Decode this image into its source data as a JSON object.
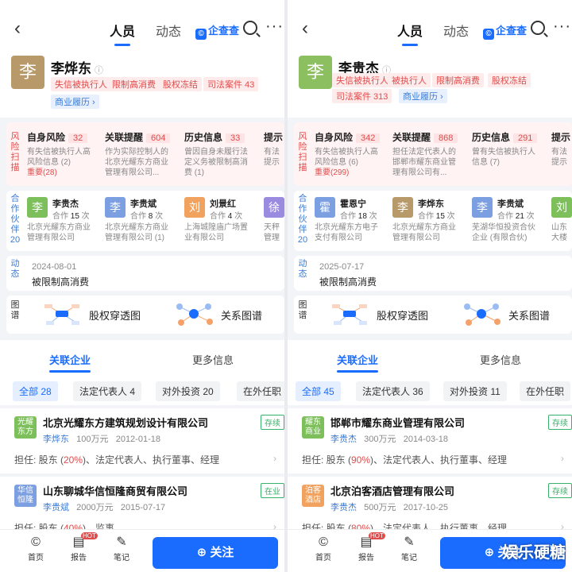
{
  "header": {
    "tab_people": "人员",
    "tab_news": "动态",
    "qcc": "企查查"
  },
  "bottom": {
    "home": "首页",
    "report": "报告",
    "hot": "HOT",
    "note": "笔记",
    "follow": "关注"
  },
  "watermark": "娱乐硬糖",
  "labels": {
    "risk": "风险扫描",
    "partners": "合作伙伴",
    "dynamic": "动态",
    "graph": "图谱",
    "equity": "股权穿透图",
    "relation": "关系图谱",
    "tab_companies": "关联企业",
    "tab_more": "更多信息",
    "biz_history": "商业履历",
    "hint": "提示"
  },
  "colors": {
    "accent": "#1a6cff",
    "risk": "#e04b4b",
    "avatar": "#b89a6a",
    "active": "#38b26a"
  },
  "left": {
    "avatar": "李",
    "name": "李烨东",
    "tags": [
      "失信被执行人",
      "限制高消费",
      "股权冻结",
      "司法案件 43"
    ],
    "risk": [
      {
        "title": "自身风险",
        "count": "32",
        "d1": "有失信被执行人高",
        "d2": "风险信息 (2)",
        "d3": "重要(28)"
      },
      {
        "title": "关联提醒",
        "count": "604",
        "d1": "作为实际控制人的",
        "d2": "北京光耀东方商业",
        "d3": "管理有限公司..."
      },
      {
        "title": "历史信息",
        "count": "33",
        "d1": "曾因自身未履行法",
        "d2": "定义务被限制高消",
        "d3": "费 (1)"
      },
      {
        "title": "提示",
        "d1": "有法",
        "d2": "提示"
      }
    ],
    "partners_count": "20",
    "partners": [
      {
        "av": "李",
        "name": "李贵杰",
        "coop": "15",
        "d1": "北京光耀东方商业",
        "d2": "管理有限公司"
      },
      {
        "av": "李",
        "name": "李贵斌",
        "coop": "8",
        "d1": "北京光耀东方商业",
        "d2": "管理有限公司 (1)"
      },
      {
        "av": "刘",
        "name": "刘景红",
        "coop": "4",
        "d1": "上海城隍庙广场置",
        "d2": "业有限公司"
      },
      {
        "av": "徐",
        "d1": "天秤",
        "d2": "管理"
      }
    ],
    "dyn_date": "2024-08-01",
    "dyn_text": "被限制高消费",
    "chips": [
      "全部 28",
      "法定代表人 4",
      "对外投资 20",
      "在外任职"
    ],
    "companies": [
      {
        "logo": "光耀东方",
        "name": "北京光耀东方建筑规划设计有限公司",
        "status": "存续",
        "person": "李烨东",
        "capital": "100万元",
        "date": "2012-01-18",
        "role_pre": "担任: 股东 (",
        "pct": "20%",
        "role_post": ")、法定代表人、执行董事、经理"
      },
      {
        "logo": "华信恒隆",
        "name": "山东聊城华信恒隆商贸有限公司",
        "status": "在业",
        "person": "李贵斌",
        "capital": "2000万元",
        "date": "2015-07-17",
        "role_pre": "担任: 股东 (",
        "pct": "40%",
        "role_post": ")、监事"
      }
    ]
  },
  "right": {
    "avatar": "李",
    "name": "李贵杰",
    "tags": [
      "失信被执行人",
      "被执行人",
      "限制高消费",
      "股权冻结",
      "司法案件 313"
    ],
    "risk": [
      {
        "title": "自身风险",
        "count": "342",
        "d1": "有失信被执行人高",
        "d2": "风险信息 (6)",
        "d3": "重要(299)"
      },
      {
        "title": "关联提醒",
        "count": "868",
        "d1": "担任法定代表人的",
        "d2": "邯郸市耀东商业管",
        "d3": "理有限公司有..."
      },
      {
        "title": "历史信息",
        "count": "291",
        "d1": "曾有失信被执行人",
        "d2": "信息 (7)",
        "d3": ""
      },
      {
        "title": "提示",
        "d1": "有法",
        "d2": "提示"
      }
    ],
    "partners_count": "20",
    "partners": [
      {
        "av": "霍",
        "name": "霍恩宁",
        "coop": "18",
        "d1": "北京光耀东方电子",
        "d2": "支付有限公司"
      },
      {
        "av": "李",
        "name": "李烨东",
        "coop": "15",
        "d1": "北京光耀东方商业",
        "d2": "管理有限公司"
      },
      {
        "av": "李",
        "name": "李贵斌",
        "coop": "21",
        "d1": "芜湖华恒投资合伙",
        "d2": "企业 (有限合伙)"
      },
      {
        "av": "刘",
        "d1": "山东",
        "d2": "大楼"
      }
    ],
    "dyn_date": "2025-07-17",
    "dyn_text": "被限制高消费",
    "chips": [
      "全部 45",
      "法定代表人 36",
      "对外投资 11",
      "在外任职"
    ],
    "companies": [
      {
        "logo": "耀东商业",
        "name": "邯郸市耀东商业管理有限公司",
        "status": "存续",
        "person": "李贵杰",
        "capital": "300万元",
        "date": "2014-03-18",
        "role_pre": "担任: 股东 (",
        "pct": "90%",
        "role_post": ")、法定代表人、执行董事、经理"
      },
      {
        "logo": "泊客酒店",
        "name": "北京泊客酒店管理有限公司",
        "status": "存续",
        "person": "李贵杰",
        "capital": "500万元",
        "date": "2017-10-25",
        "role_pre": "担任: 股东 (",
        "pct": "80%",
        "role_post": ")、法定代表人、执行董事、经理"
      }
    ]
  }
}
